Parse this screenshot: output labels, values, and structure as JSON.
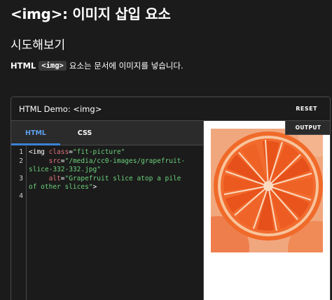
{
  "page": {
    "title": "<img>: 이미지 삽입 요소",
    "section_title": "시도해보기",
    "intro_strong": "HTML",
    "intro_code": "<img>",
    "intro_rest": "요소는 문서에 이미지를 넣습니다."
  },
  "demo": {
    "title": "HTML Demo: <img>",
    "reset_label": "RESET",
    "output_label": "OUTPUT",
    "tabs": [
      {
        "label": "HTML",
        "active": true
      },
      {
        "label": "CSS",
        "active": false
      }
    ],
    "line_numbers": [
      "1",
      "2",
      "3",
      "4"
    ],
    "code": {
      "l1_open": "<img ",
      "l1_attr": "class",
      "l1_eq": "=",
      "l1_val": "\"fit-picture\"",
      "l2_indent": "     ",
      "l2_attr": "src",
      "l2_eq": "=",
      "l2_val": "\"/media/cc0-images/grapefruit-",
      "l2b_val": "slice-332-332.jpg\"",
      "l3_indent": "     ",
      "l3_attr": "alt",
      "l3_eq": "=",
      "l3_val": "\"Grapefruit slice atop a pile",
      "l3b_val": "of other slices\"",
      "l3b_close": ">"
    }
  },
  "colors": {
    "background": "#1b1b1b",
    "accent_tab": "#5da0ee",
    "attr": "#e0737b",
    "string": "#6cd27c"
  },
  "output_image": {
    "alt": "Grapefruit slice atop a pile of other slices",
    "icon": "grapefruit-image"
  }
}
